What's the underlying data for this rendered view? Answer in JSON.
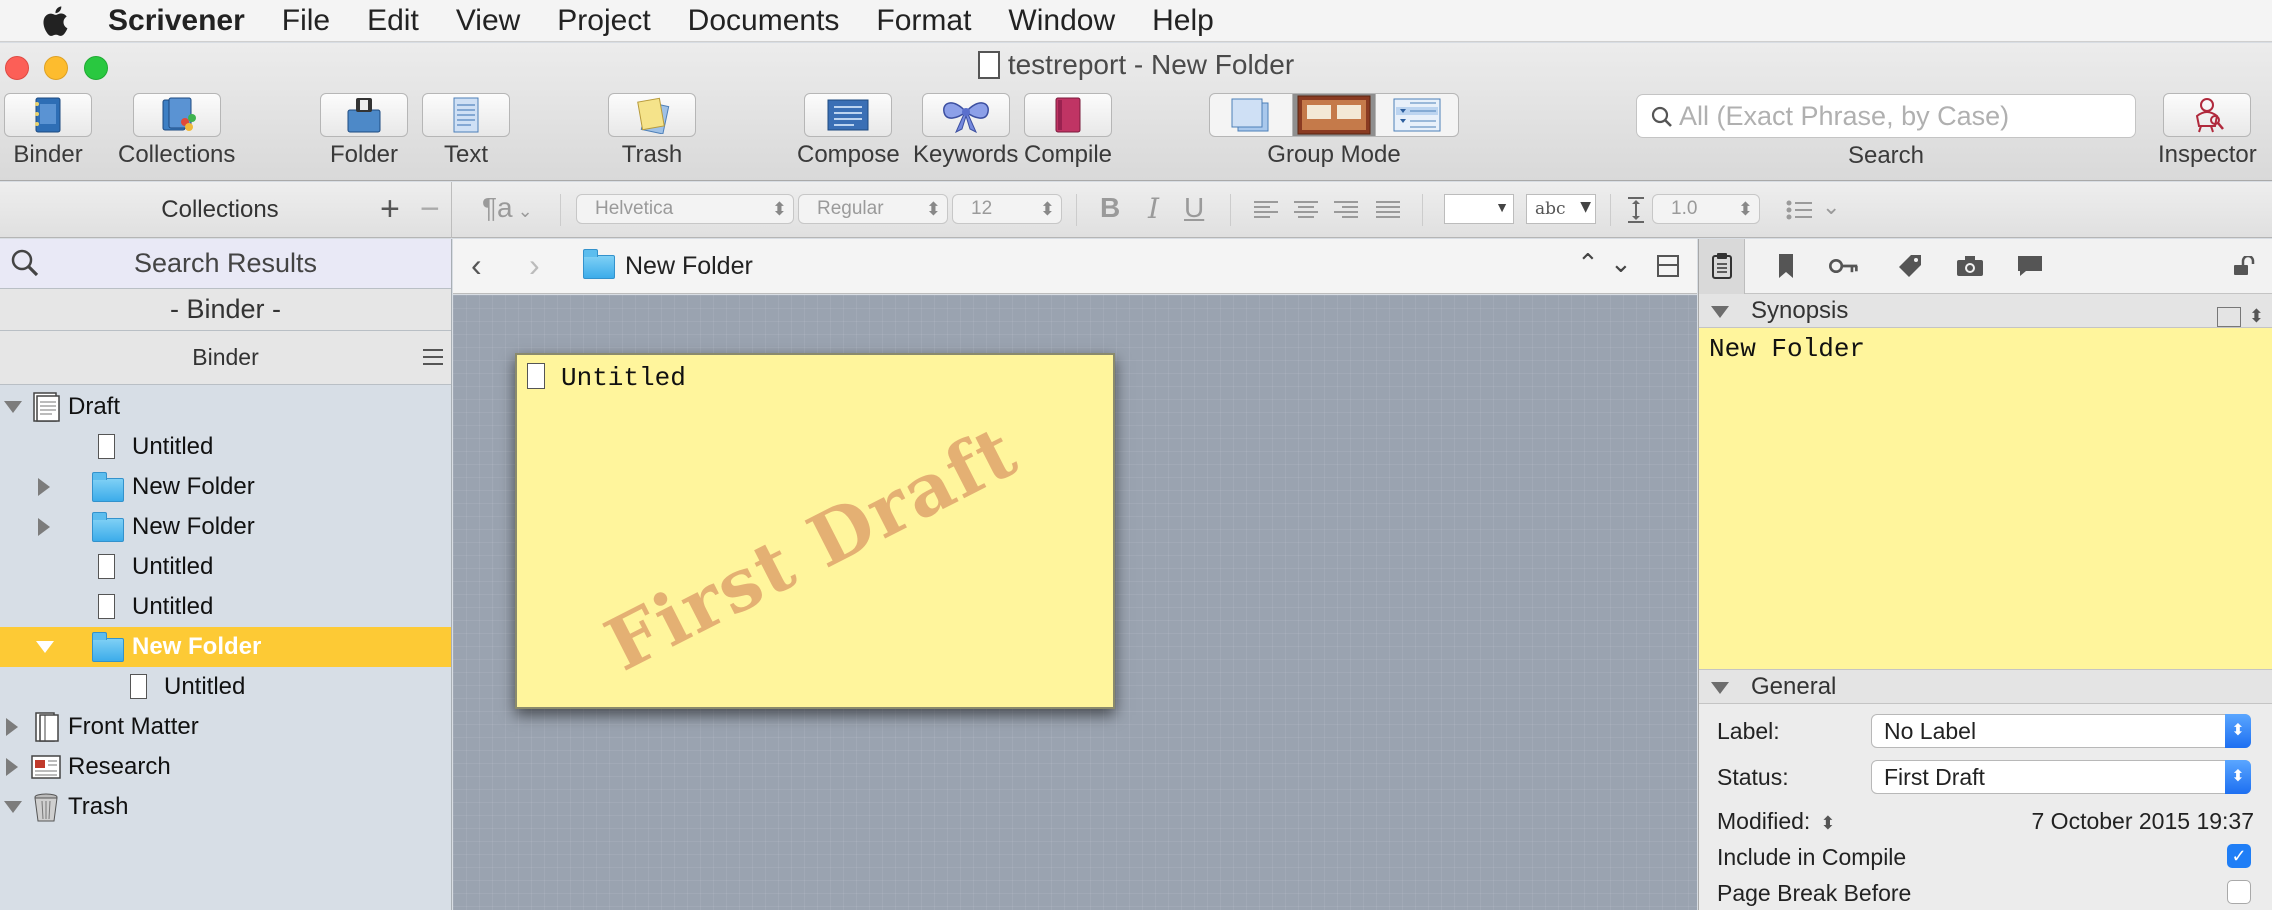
{
  "menubar": {
    "app": "Scrivener",
    "items": [
      "File",
      "Edit",
      "View",
      "Project",
      "Documents",
      "Format",
      "Window",
      "Help"
    ]
  },
  "window": {
    "title": "testreport - New Folder"
  },
  "toolbar": {
    "binder": "Binder",
    "collections": "Collections",
    "folder": "Folder",
    "text": "Text",
    "trash": "Trash",
    "compose": "Compose",
    "keywords": "Keywords",
    "compile": "Compile",
    "group_mode": "Group Mode",
    "search_placeholder": "All (Exact Phrase, by Case)",
    "search_label": "Search",
    "inspector": "Inspector"
  },
  "formatbar": {
    "paragraph": "¶a",
    "font": "Helvetica",
    "style": "Regular",
    "size": "12",
    "bold": "B",
    "italic": "I",
    "underline": "U",
    "highlight": "abc",
    "line_spacing": "1.0"
  },
  "collections": {
    "title": "Collections"
  },
  "binder": {
    "search_results": "Search Results",
    "binder_dash": "- Binder -",
    "header": "Binder",
    "rows": [
      {
        "label": "Draft",
        "type": "draft",
        "level": 0,
        "disclosure": "down"
      },
      {
        "label": "Untitled",
        "type": "doc",
        "level": 1,
        "disclosure": "none"
      },
      {
        "label": "New Folder",
        "type": "folder",
        "level": 1,
        "disclosure": "right"
      },
      {
        "label": "New Folder",
        "type": "folder",
        "level": 1,
        "disclosure": "right"
      },
      {
        "label": "Untitled",
        "type": "doc",
        "level": 1,
        "disclosure": "none"
      },
      {
        "label": "Untitled",
        "type": "doc",
        "level": 1,
        "disclosure": "none"
      },
      {
        "label": "New Folder",
        "type": "folder",
        "level": 1,
        "disclosure": "down",
        "selected": true
      },
      {
        "label": "Untitled",
        "type": "doc",
        "level": 2,
        "disclosure": "none"
      },
      {
        "label": "Front Matter",
        "type": "frontmatter",
        "level": 0,
        "disclosure": "right"
      },
      {
        "label": "Research",
        "type": "research",
        "level": 0,
        "disclosure": "right"
      },
      {
        "label": "Trash",
        "type": "trash",
        "level": 0,
        "disclosure": "down"
      }
    ]
  },
  "editor": {
    "title": "New Folder",
    "card": {
      "title": "Untitled",
      "stamp": "First Draft"
    }
  },
  "inspector": {
    "synopsis_header": "Synopsis",
    "synopsis_text": "New Folder",
    "general_header": "General",
    "label_field": "Label:",
    "label_value": "No Label",
    "status_field": "Status:",
    "status_value": "First Draft",
    "modified_field": "Modified:",
    "modified_value": "7 October 2015 19:37",
    "include_compile": "Include in Compile",
    "include_compile_checked": true,
    "page_break": "Page Break Before",
    "page_break_checked": false
  },
  "colors": {
    "selection": "#fdca35",
    "card": "#fff59c",
    "stamp": "#da9664",
    "corkboard": "#9aa3b0",
    "accent": "#1f7ef6"
  }
}
